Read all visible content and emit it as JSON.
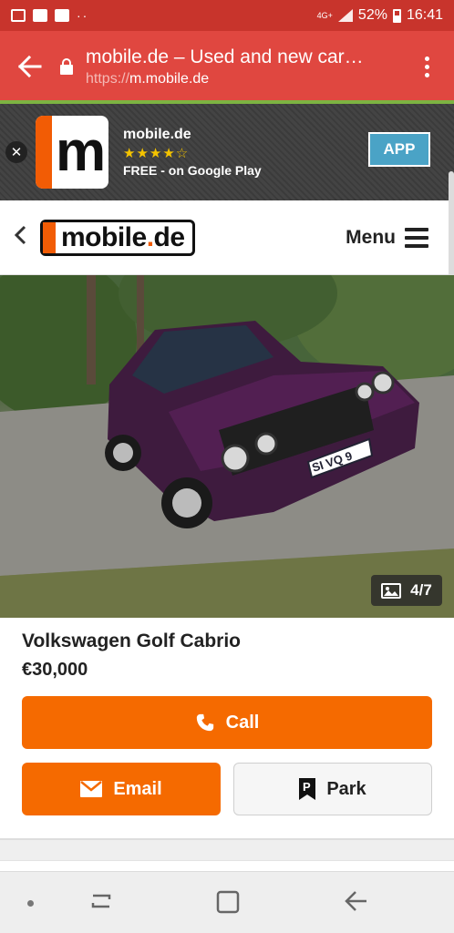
{
  "status_bar": {
    "dots": "··",
    "network": "4G+",
    "battery": "52%",
    "time": "16:41"
  },
  "browser": {
    "page_title": "mobile.de – Used and new car…",
    "url_scheme": "https://",
    "url_host": "m.mobile.de"
  },
  "app_banner": {
    "app_name": "mobile.de",
    "rating_stars": "★★★★☆",
    "subtitle": "FREE - on Google Play",
    "button_label": "APP",
    "logo_letter": "m"
  },
  "site_header": {
    "logo_text_main": "mobile",
    "logo_text_dot": ".",
    "logo_text_tld": "de",
    "menu_label": "Menu"
  },
  "photo": {
    "counter": "4/7",
    "plate": "SI VQ 9"
  },
  "listing": {
    "title": "Volkswagen Golf Cabrio",
    "price": "€30,000",
    "call_label": "Call",
    "email_label": "Email",
    "park_label": "Park"
  },
  "colors": {
    "status_bar": "#c8342c",
    "browser_bar": "#e04740",
    "accent_orange": "#f56a00",
    "app_button": "#4aa3c6"
  }
}
